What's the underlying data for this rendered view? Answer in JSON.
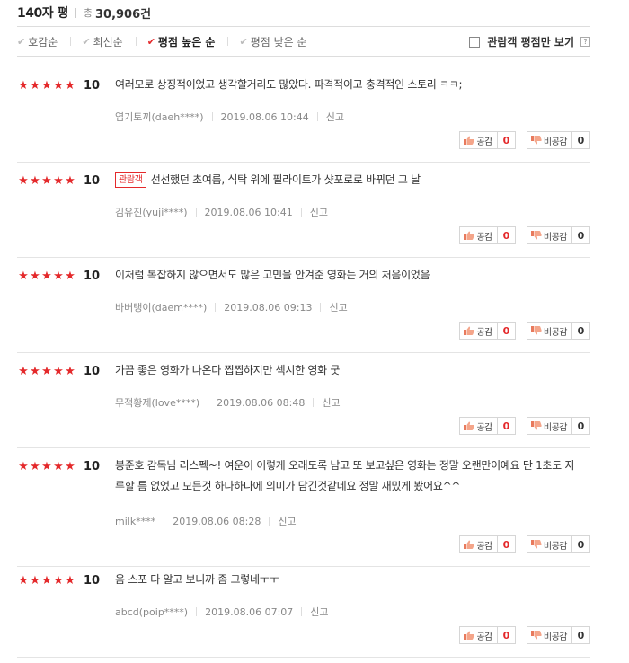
{
  "header": {
    "title": "140자 평",
    "total_label": "총",
    "total_count": "30,906건"
  },
  "sort": [
    {
      "label": "호감순",
      "active": false
    },
    {
      "label": "최신순",
      "active": false
    },
    {
      "label": "평점 높은 순",
      "active": true
    },
    {
      "label": "평점 낮은 순",
      "active": false
    }
  ],
  "filter": {
    "label": "관람객 평점만 보기",
    "help": "?",
    "checked": false
  },
  "icons": {
    "star": "star-icon",
    "check": "check-icon",
    "thumbs_up": "thumbs-up-icon",
    "thumbs_down": "thumbs-down-icon",
    "checkbox": "checkbox-icon",
    "help": "help-icon"
  },
  "colors": {
    "accent": "#e4292b"
  },
  "labels": {
    "like": "공감",
    "dislike": "비공감",
    "report": "신고",
    "badge": "관람객"
  },
  "reviews": [
    {
      "stars": 5,
      "score": "10",
      "badge": false,
      "text": "여러모로 상징적이었고 생각할거리도 많았다. 파격적이고 충격적인 스토리 ㅋㅋ;",
      "author": "엽기토끼(daeh****)",
      "date": "2019.08.06 10:44",
      "likes": "0",
      "dislikes": "0"
    },
    {
      "stars": 5,
      "score": "10",
      "badge": true,
      "text": "선선했던 초여름, 식탁 위에 필라이트가 샷포로로 바뀌던 그 날",
      "author": "김유진(yuji****)",
      "date": "2019.08.06 10:41",
      "likes": "0",
      "dislikes": "0"
    },
    {
      "stars": 5,
      "score": "10",
      "badge": false,
      "text": "이처럼 복잡하지 않으면서도 많은 고민을 안겨준 영화는 거의 처음이었음",
      "author": "바버탱이(daem****)",
      "date": "2019.08.06 09:13",
      "likes": "0",
      "dislikes": "0"
    },
    {
      "stars": 5,
      "score": "10",
      "badge": false,
      "text": "가끔 좋은 영화가 나온다 찝찝하지만 섹시한 영화 굿",
      "author": "무적황제(love****)",
      "date": "2019.08.06 08:48",
      "likes": "0",
      "dislikes": "0"
    },
    {
      "stars": 5,
      "score": "10",
      "badge": false,
      "text": "봉준호 감독님 리스펙~! 여운이 이렇게 오래도록 남고 또 보고싶은 영화는 정말 오랜만이예요 단 1초도 지루할 틈 없었고 모든것 하나하나에 의미가 담긴것같네요 정말 재밌게 봤어요^^",
      "author": "milk****",
      "date": "2019.08.06 08:28",
      "likes": "0",
      "dislikes": "0"
    },
    {
      "stars": 5,
      "score": "10",
      "badge": false,
      "text": "음 스포 다 알고 보니까 좀 그렇네ㅜㅜ",
      "author": "abcd(poip****)",
      "date": "2019.08.06 07:07",
      "likes": "0",
      "dislikes": "0"
    }
  ]
}
